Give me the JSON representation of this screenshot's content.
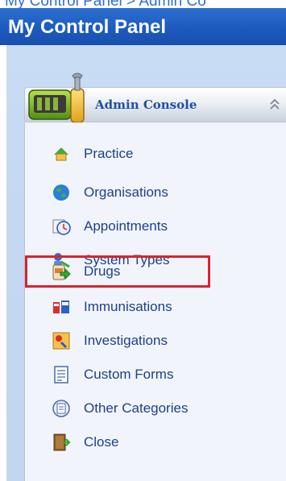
{
  "breadcrumb": "My Control Panel > Admin Co",
  "panel": {
    "title": "My Control Panel"
  },
  "console": {
    "title": "Admin Console",
    "collapse_icon": "double-chevron-up-icon"
  },
  "menu": [
    {
      "label": "Practice",
      "icon": "practice-icon"
    },
    {
      "label": "Organisations",
      "icon": "globe-icon"
    },
    {
      "label": "Appointments",
      "icon": "clock-icon"
    },
    {
      "label": "System Types",
      "icon": "system-types-icon"
    },
    {
      "label": "Drugs",
      "icon": "drugs-icon",
      "highlighted": true
    },
    {
      "label": "Immunisations",
      "icon": "immunisation-icon"
    },
    {
      "label": "Investigations",
      "icon": "investigations-icon"
    },
    {
      "label": "Custom Forms",
      "icon": "form-icon"
    },
    {
      "label": "Other Categories",
      "icon": "categories-icon"
    },
    {
      "label": "Close",
      "icon": "door-icon"
    }
  ],
  "colors": {
    "titlebar": "#1d5bbf",
    "highlight": "#d9242f",
    "link": "#1d3f8a"
  }
}
